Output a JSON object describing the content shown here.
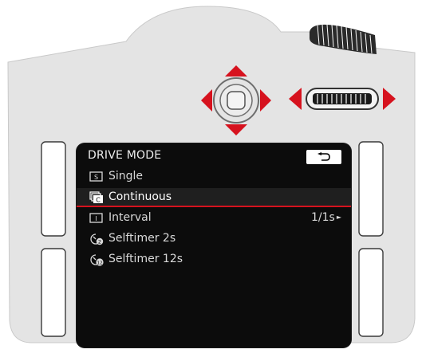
{
  "menu": {
    "title": "DRIVE MODE",
    "items": [
      {
        "label": "Single",
        "value": "",
        "icon": "single-shot-icon",
        "selected": false
      },
      {
        "label": "Continuous",
        "value": "",
        "icon": "continuous-shot-icon",
        "selected": true
      },
      {
        "label": "Interval",
        "value": "1/1s",
        "icon": "interval-icon",
        "selected": false
      },
      {
        "label": "Selftimer 2s",
        "value": "",
        "icon": "selftimer-2s-icon",
        "selected": false
      },
      {
        "label": "Selftimer 12s",
        "value": "",
        "icon": "selftimer-12s-icon",
        "selected": false
      }
    ]
  },
  "colors": {
    "accent": "#d6121e",
    "body": "#e3e3e3",
    "outline": "#8a8a8a",
    "screen": "#0c0c0c"
  },
  "icons": {
    "back": "back-arrow-icon",
    "up": "arrow-up-icon",
    "down": "arrow-down-icon",
    "left": "arrow-left-icon",
    "right": "arrow-right-icon",
    "dial": "thumbwheel-icon"
  }
}
